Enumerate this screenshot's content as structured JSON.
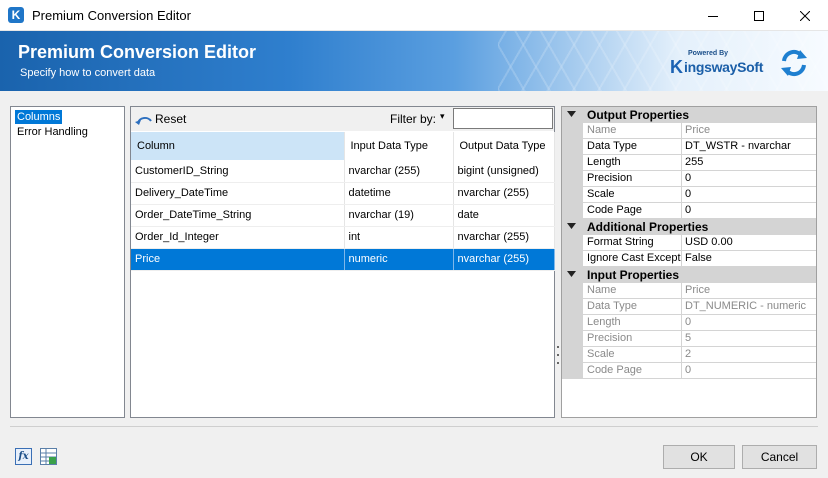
{
  "window": {
    "title": "Premium Conversion Editor",
    "app_icon_letter": "K"
  },
  "header": {
    "title": "Premium Conversion Editor",
    "subtitle": "Specify how to convert data",
    "logo_powered": "Powered By",
    "logo_mark": "K",
    "logo_brand": "ingswaySoft"
  },
  "nav": {
    "items": [
      "Columns",
      "Error Handling"
    ],
    "selected": 0
  },
  "toolbar": {
    "reset_label": "Reset",
    "filter_label": "Filter by:",
    "filter_dropdown": "▾",
    "filter_value": ""
  },
  "grid": {
    "columns": [
      "Column",
      "Input Data Type",
      "Output Data Type"
    ],
    "rows": [
      [
        "CustomerID_String",
        "nvarchar (255)",
        "bigint (unsigned)"
      ],
      [
        "Delivery_DateTime",
        "datetime",
        "nvarchar (255)"
      ],
      [
        "Order_DateTime_String",
        "nvarchar (19)",
        "date"
      ],
      [
        "Order_Id_Integer",
        "int",
        "nvarchar (255)"
      ],
      [
        "Price",
        "numeric",
        "nvarchar (255)"
      ]
    ],
    "selected_row": 4
  },
  "properties": {
    "output": {
      "label": "Output Properties",
      "rows": [
        [
          "Name",
          "Price"
        ],
        [
          "Data Type",
          "DT_WSTR - nvarchar"
        ],
        [
          "Length",
          "255"
        ],
        [
          "Precision",
          "0"
        ],
        [
          "Scale",
          "0"
        ],
        [
          "Code Page",
          "0"
        ]
      ]
    },
    "additional": {
      "label": "Additional Properties",
      "rows": [
        [
          "Format String",
          "USD 0.00"
        ],
        [
          "Ignore Cast Exception",
          "False"
        ]
      ]
    },
    "input": {
      "label": "Input Properties",
      "rows": [
        [
          "Name",
          "Price"
        ],
        [
          "Data Type",
          "DT_NUMERIC - numeric"
        ],
        [
          "Length",
          "0"
        ],
        [
          "Precision",
          "5"
        ],
        [
          "Scale",
          "2"
        ],
        [
          "Code Page",
          "0"
        ]
      ]
    }
  },
  "footer": {
    "fx_label": "fx",
    "ok_label": "OK",
    "cancel_label": "Cancel"
  },
  "colors": {
    "accent": "#0078d7",
    "header_blue": "#1a63ad",
    "category_gray": "#d4d4d4"
  }
}
